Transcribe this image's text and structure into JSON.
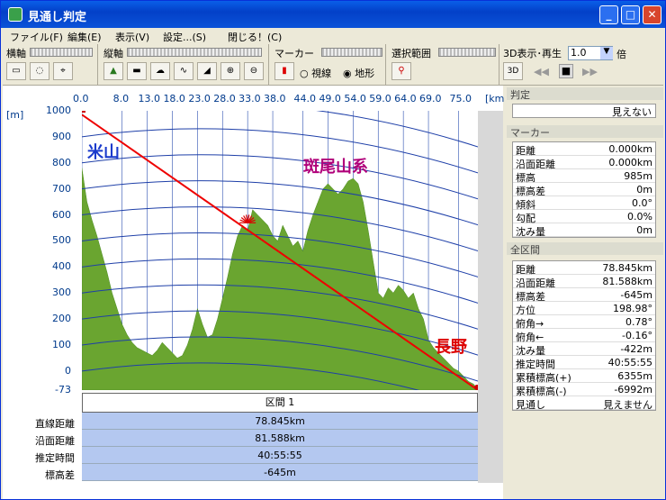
{
  "window": {
    "title": "見通し判定"
  },
  "menu": [
    "ファイル(F)",
    "編集(E)",
    "表示(V)",
    "設定...(S)",
    "閉じる！(C)"
  ],
  "toolbar": {
    "horizontal_label": "横軸",
    "vertical_label": "縦軸",
    "marker_label": "マーカー",
    "range_label": "選択範囲",
    "play_label": "3D表示･再生",
    "speed_value": "1.0",
    "speed_unit": "倍",
    "radio_sight": "視線",
    "radio_terrain": "地形",
    "btn_3d": "3D"
  },
  "chart_data": {
    "type": "area",
    "xunit": "[km]",
    "yunit": "[m]",
    "x_ticks": [
      "0.0",
      "8.0",
      "13.0",
      "18.0",
      "23.0",
      "28.0",
      "33.0",
      "38.0",
      "44.0",
      "49.0",
      "54.0",
      "59.0",
      "64.0",
      "69.0",
      "75.0"
    ],
    "y_ticks": [
      "1000",
      "900",
      "800",
      "700",
      "600",
      "500",
      "400",
      "300",
      "200",
      "100",
      "0",
      "-73"
    ],
    "ylim": [
      -73,
      1000
    ],
    "labels": {
      "start": "米山",
      "mid": "斑尾山系",
      "end": "長野"
    },
    "terrain": [
      [
        0,
        780
      ],
      [
        1,
        650
      ],
      [
        2,
        580
      ],
      [
        3,
        520
      ],
      [
        4,
        450
      ],
      [
        5,
        380
      ],
      [
        6,
        300
      ],
      [
        7,
        240
      ],
      [
        8,
        180
      ],
      [
        9,
        140
      ],
      [
        10,
        110
      ],
      [
        11,
        90
      ],
      [
        12,
        80
      ],
      [
        13,
        70
      ],
      [
        14,
        60
      ],
      [
        15,
        80
      ],
      [
        16,
        110
      ],
      [
        17,
        90
      ],
      [
        18,
        70
      ],
      [
        19,
        50
      ],
      [
        20,
        60
      ],
      [
        21,
        100
      ],
      [
        22,
        160
      ],
      [
        23,
        240
      ],
      [
        24,
        180
      ],
      [
        25,
        130
      ],
      [
        26,
        140
      ],
      [
        27,
        200
      ],
      [
        28,
        280
      ],
      [
        29,
        360
      ],
      [
        30,
        450
      ],
      [
        31,
        520
      ],
      [
        32,
        560
      ],
      [
        33,
        540
      ],
      [
        34,
        620
      ],
      [
        35,
        600
      ],
      [
        36,
        580
      ],
      [
        37,
        560
      ],
      [
        38,
        520
      ],
      [
        39,
        500
      ],
      [
        40,
        560
      ],
      [
        41,
        520
      ],
      [
        42,
        480
      ],
      [
        43,
        500
      ],
      [
        44,
        460
      ],
      [
        45,
        540
      ],
      [
        46,
        600
      ],
      [
        47,
        650
      ],
      [
        48,
        700
      ],
      [
        49,
        720
      ],
      [
        50,
        700
      ],
      [
        51,
        680
      ],
      [
        52,
        700
      ],
      [
        53,
        730
      ],
      [
        54,
        740
      ],
      [
        55,
        720
      ],
      [
        56,
        650
      ],
      [
        57,
        540
      ],
      [
        58,
        420
      ],
      [
        59,
        300
      ],
      [
        60,
        280
      ],
      [
        61,
        320
      ],
      [
        62,
        300
      ],
      [
        63,
        330
      ],
      [
        64,
        310
      ],
      [
        65,
        280
      ],
      [
        66,
        300
      ],
      [
        67,
        240
      ],
      [
        68,
        200
      ],
      [
        69,
        120
      ],
      [
        70,
        90
      ],
      [
        71,
        70
      ],
      [
        72,
        50
      ],
      [
        73,
        30
      ],
      [
        74,
        10
      ],
      [
        75,
        0
      ],
      [
        76,
        -20
      ],
      [
        77,
        -40
      ],
      [
        78,
        -50
      ],
      [
        78.845,
        -73
      ]
    ],
    "sight_line": {
      "from": [
        0,
        985
      ],
      "to": [
        78.845,
        -73
      ]
    },
    "marker_peak_km": 33
  },
  "stats": {
    "section": "区間 1",
    "labels": [
      "直線距離",
      "沿面距離",
      "推定時間",
      "標高差"
    ],
    "values": [
      "78.845km",
      "81.588km",
      "40:55:55",
      "-645m"
    ]
  },
  "sidebar": {
    "judge_head": "判定",
    "judge_value": "見えない",
    "marker_head": "マーカー",
    "marker_rows": [
      {
        "k": "距離",
        "v": "0.000km"
      },
      {
        "k": "沿面距離",
        "v": "0.000km"
      },
      {
        "k": "標高",
        "v": "985m"
      },
      {
        "k": "標高差",
        "v": "0m"
      },
      {
        "k": "傾斜",
        "v": "0.0°"
      },
      {
        "k": "勾配",
        "v": "0.0%"
      },
      {
        "k": "沈み量",
        "v": "0m"
      }
    ],
    "all_head": "全区間",
    "all_rows": [
      {
        "k": "距離",
        "v": "78.845km"
      },
      {
        "k": "沿面距離",
        "v": "81.588km"
      },
      {
        "k": "標高差",
        "v": "-645m"
      },
      {
        "k": "方位",
        "v": "198.98°"
      },
      {
        "k": "俯角→",
        "v": "0.78°"
      },
      {
        "k": "俯角←",
        "v": "-0.16°"
      },
      {
        "k": "沈み量",
        "v": "-422m"
      },
      {
        "k": "推定時間",
        "v": "40:55:55"
      },
      {
        "k": "累積標高(+)",
        "v": "6355m"
      },
      {
        "k": "累積標高(-)",
        "v": "-6992m"
      },
      {
        "k": "見通し",
        "v": "見えません"
      }
    ]
  }
}
